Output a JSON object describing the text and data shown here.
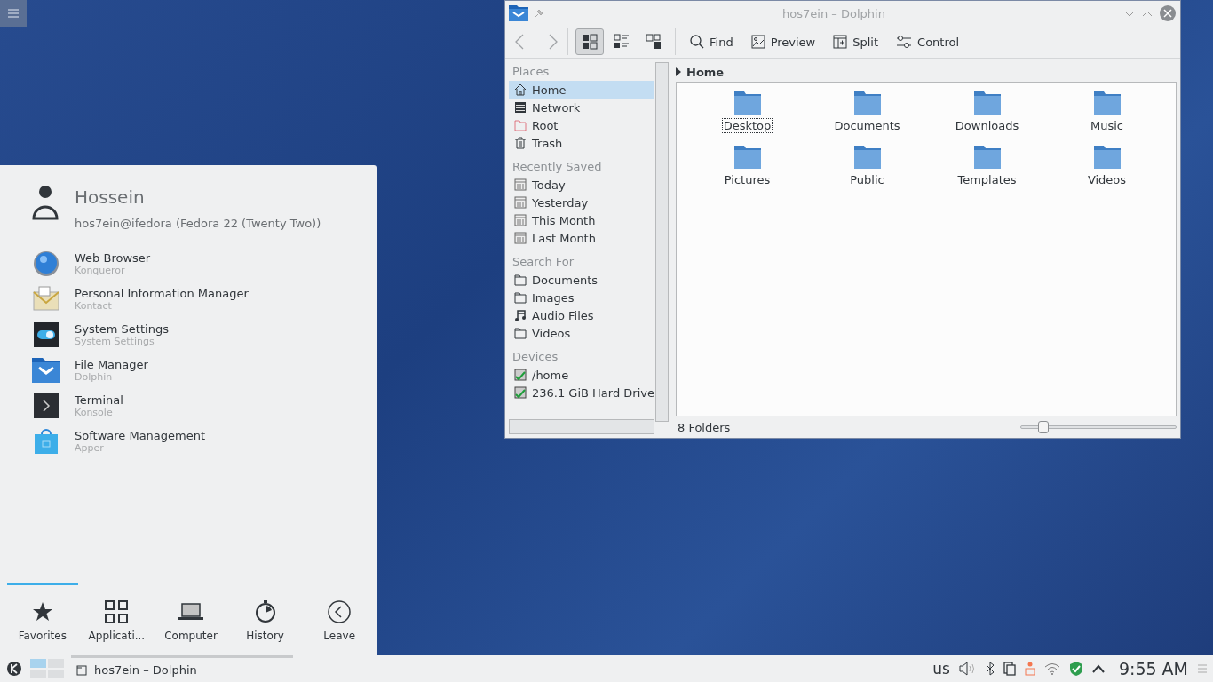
{
  "launcher": {
    "user": {
      "name": "Hossein",
      "subtitle": "hos7ein@ifedora (Fedora 22 (Twenty Two))"
    },
    "favorites": [
      {
        "name": "Web Browser",
        "generic": "Konqueror",
        "kind": "globe"
      },
      {
        "name": "Personal Information Manager",
        "generic": "Kontact",
        "kind": "mail"
      },
      {
        "name": "System Settings",
        "generic": "System Settings",
        "kind": "toggle"
      },
      {
        "name": "File Manager",
        "generic": "Dolphin",
        "kind": "folder"
      },
      {
        "name": "Terminal",
        "generic": "Konsole",
        "kind": "terminal"
      },
      {
        "name": "Software Management",
        "generic": "Apper",
        "kind": "bag"
      }
    ],
    "tabs": [
      {
        "label": "Favorites",
        "kind": "star",
        "selected": true
      },
      {
        "label": "Applicati...",
        "kind": "grid",
        "selected": false
      },
      {
        "label": "Computer",
        "kind": "laptop",
        "selected": false
      },
      {
        "label": "History",
        "kind": "clock",
        "selected": false
      },
      {
        "label": "Leave",
        "kind": "leave",
        "selected": false
      }
    ]
  },
  "dolphin": {
    "title": "hos7ein – Dolphin",
    "view_modes": [
      {
        "kind": "icons",
        "selected": true
      },
      {
        "kind": "compact",
        "selected": false
      },
      {
        "kind": "details",
        "selected": false
      }
    ],
    "actions": [
      {
        "label": "Find",
        "kind": "find"
      },
      {
        "label": "Preview",
        "kind": "preview"
      },
      {
        "label": "Split",
        "kind": "split"
      },
      {
        "label": "Control",
        "kind": "control"
      }
    ],
    "places": [
      {
        "title": "Places",
        "items": [
          {
            "label": "Home",
            "kind": "home",
            "selected": true
          },
          {
            "label": "Network",
            "kind": "network",
            "selected": false
          },
          {
            "label": "Root",
            "kind": "root",
            "selected": false
          },
          {
            "label": "Trash",
            "kind": "trash",
            "selected": false
          }
        ]
      },
      {
        "title": "Recently Saved",
        "items": [
          {
            "label": "Today",
            "kind": "calendar",
            "selected": false
          },
          {
            "label": "Yesterday",
            "kind": "calendar",
            "selected": false
          },
          {
            "label": "This Month",
            "kind": "calendar",
            "selected": false
          },
          {
            "label": "Last Month",
            "kind": "calendar",
            "selected": false
          }
        ]
      },
      {
        "title": "Search For",
        "items": [
          {
            "label": "Documents",
            "kind": "folder",
            "selected": false
          },
          {
            "label": "Images",
            "kind": "folder",
            "selected": false
          },
          {
            "label": "Audio Files",
            "kind": "music",
            "selected": false
          },
          {
            "label": "Videos",
            "kind": "folder",
            "selected": false
          }
        ]
      },
      {
        "title": "Devices",
        "items": [
          {
            "label": "/home",
            "kind": "drive",
            "selected": false
          },
          {
            "label": "236.1 GiB Hard Drive",
            "kind": "drive",
            "selected": false
          }
        ]
      }
    ],
    "breadcrumb": "Home",
    "folders": [
      {
        "name": "Desktop",
        "focused": true
      },
      {
        "name": "Documents",
        "focused": false
      },
      {
        "name": "Downloads",
        "focused": false
      },
      {
        "name": "Music",
        "focused": false
      },
      {
        "name": "Pictures",
        "focused": false
      },
      {
        "name": "Public",
        "focused": false
      },
      {
        "name": "Templates",
        "focused": false
      },
      {
        "name": "Videos",
        "focused": false
      }
    ],
    "status": "8 Folders",
    "zoom": {
      "level": 0.15
    }
  },
  "taskbar": {
    "pager": [
      {
        "selected": true
      },
      {
        "selected": false
      },
      {
        "selected": false
      },
      {
        "selected": false
      }
    ],
    "tasks": [
      {
        "label": "hos7ein – Dolphin"
      }
    ],
    "keyboard_layout": "us",
    "clock": "9:55 AM"
  }
}
